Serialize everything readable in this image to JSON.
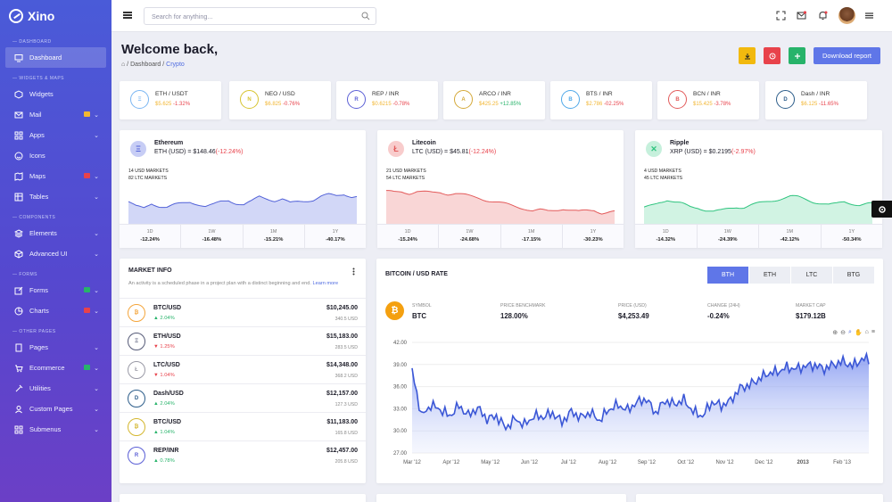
{
  "app": {
    "name": "Xino"
  },
  "sidebar": {
    "sections": [
      "DASHBOARD",
      "WIDGETS & MAPS",
      "COMPONENTS",
      "FORMS",
      "OTHER PAGES"
    ],
    "items": [
      {
        "label": "Dashboard"
      },
      {
        "label": "Widgets"
      },
      {
        "label": "Mail",
        "badge": "5"
      },
      {
        "label": "Apps"
      },
      {
        "label": "Icons"
      },
      {
        "label": "Maps",
        "badge": "2"
      },
      {
        "label": "Tables"
      },
      {
        "label": "Elements"
      },
      {
        "label": "Advanced UI"
      },
      {
        "label": "Forms",
        "badge": "4"
      },
      {
        "label": "Charts",
        "badge": "6"
      },
      {
        "label": "Pages"
      },
      {
        "label": "Ecommerce",
        "badge": "9"
      },
      {
        "label": "Utilities"
      },
      {
        "label": "Custom Pages"
      },
      {
        "label": "Submenus"
      }
    ]
  },
  "topbar": {
    "search_placeholder": "Search for anything..."
  },
  "page": {
    "title": "Welcome back,",
    "breadcrumb": [
      "Dashboard",
      "Crypto"
    ],
    "download_label": "Download report"
  },
  "tickers": [
    {
      "pair": "ETH / USDT",
      "price": "$5.625",
      "change": "-1.32%",
      "color": "#7ab6f2",
      "sym": "Ξ"
    },
    {
      "pair": "NEO / USD",
      "price": "$6.825",
      "change": "-0.76%",
      "color": "#d7c42f",
      "sym": "N"
    },
    {
      "pair": "REP / INR",
      "price": "$0.6215",
      "change": "-0.78%",
      "color": "#5b5fd6",
      "sym": "R"
    },
    {
      "pair": "ARCO / INR",
      "price": "$425.25",
      "change": "+12.85%",
      "color": "#d4a838",
      "sym": "A"
    },
    {
      "pair": "BTS / INR",
      "price": "$2.786",
      "change": "-02.25%",
      "color": "#4fa8e8",
      "sym": "B"
    },
    {
      "pair": "BCN / INR",
      "price": "$15.425",
      "change": "-3.78%",
      "color": "#e25b5b",
      "sym": "B"
    },
    {
      "pair": "Dash / INR",
      "price": "$6.125",
      "change": "-11.65%",
      "color": "#2c5d8a",
      "sym": "D"
    }
  ],
  "coins": [
    {
      "name": "Ethereum",
      "price_text": "ETH (USD) = $148.46",
      "change": "(-12.24%)",
      "m1": "14 USD MARKETS",
      "m2": "82 LTC MARKETS",
      "color": "#5161d8",
      "stats": [
        {
          "l": "1D",
          "v": "-12.24%"
        },
        {
          "l": "1W",
          "v": "-16.48%"
        },
        {
          "l": "1M",
          "v": "-15.21%"
        },
        {
          "l": "1Y",
          "v": "-40.17%"
        }
      ]
    },
    {
      "name": "Litecoin",
      "price_text": "LTC (USD) = $45.81",
      "change": "(-12.24%)",
      "m1": "21 USD MARKETS",
      "m2": "54 LTC MARKETS",
      "color": "#e35a5a",
      "stats": [
        {
          "l": "1D",
          "v": "-15.24%"
        },
        {
          "l": "1W",
          "v": "-24.68%"
        },
        {
          "l": "1M",
          "v": "-17.15%"
        },
        {
          "l": "1Y",
          "v": "-30.23%"
        }
      ]
    },
    {
      "name": "Ripple",
      "price_text": "XRP (USD) = $0.2195",
      "change": "(-2.97%)",
      "m1": "4 USD MARKETS",
      "m2": "45 LTC MARKETS",
      "color": "#2fc47f",
      "stats": [
        {
          "l": "1D",
          "v": "-14.32%"
        },
        {
          "l": "1W",
          "v": "-24.39%"
        },
        {
          "l": "1M",
          "v": "-42.12%"
        },
        {
          "l": "1Y",
          "v": "-50.34%"
        }
      ]
    }
  ],
  "market": {
    "title": "MARKET INFO",
    "desc": "An activity is a scheduled phase in a project plan with a distinct beginning and end.",
    "learn": "Learn more",
    "rows": [
      {
        "pair": "BTC/USD",
        "change": "2.04%",
        "dir": "up",
        "value": "$10,245.00",
        "sub": "340.5 USD",
        "color": "#f4a53b",
        "sym": "₿"
      },
      {
        "pair": "ETH/USD",
        "change": "1.25%",
        "dir": "down",
        "value": "$15,183.00",
        "sub": "283.5 USD",
        "color": "#555a77",
        "sym": "Ξ"
      },
      {
        "pair": "LTC/USD",
        "change": "1.04%",
        "dir": "down",
        "value": "$14,348.00",
        "sub": "368.2 USD",
        "color": "#9a9aa6",
        "sym": "Ł"
      },
      {
        "pair": "Dash/USD",
        "change": "2.04%",
        "dir": "up",
        "value": "$12,157.00",
        "sub": "127.3 USD",
        "color": "#2c5d8a",
        "sym": "D"
      },
      {
        "pair": "BTC/USD",
        "change": "1.04%",
        "dir": "up",
        "value": "$11,183.00",
        "sub": "165.8 USD",
        "color": "#d4b72f",
        "sym": "₿"
      },
      {
        "pair": "REP/INR",
        "change": "0.78%",
        "dir": "up",
        "value": "$12,457.00",
        "sub": "205.8 USD",
        "color": "#5b5fd6",
        "sym": "R"
      }
    ]
  },
  "rate": {
    "title": "BITCOIN / USD RATE",
    "tabs": [
      "BTH",
      "ETH",
      "LTC",
      "BTG"
    ],
    "info": [
      {
        "k": "SYMBOL",
        "v": "BTC"
      },
      {
        "k": "PRICE BENCHMARK",
        "v": "128.00%"
      },
      {
        "k": "PRICE (USD)",
        "v": "$4,253.49"
      },
      {
        "k": "CHANGE (24H)",
        "v": "-0.24%"
      },
      {
        "k": "MARKET CAP",
        "v": "$179.12B"
      }
    ]
  },
  "chart_data": {
    "type": "area",
    "x": [
      "Mar '12",
      "Apr '12",
      "May '12",
      "Jun '12",
      "Jul '12",
      "Aug '12",
      "Sep '12",
      "Oct '12",
      "Nov '12",
      "Dec '12",
      "2013",
      "Feb '13"
    ],
    "ylim": [
      27,
      42
    ],
    "yticks": [
      "42.00",
      "39.00",
      "36.00",
      "33.00",
      "30.00",
      "27.00"
    ],
    "series": [
      {
        "values": [
          38.2,
          32.0,
          33.5,
          32.9,
          32.0,
          33.4,
          32.1,
          33.1,
          31.6,
          32.0,
          30.4,
          31.6,
          30.8,
          32.0,
          31.9,
          32.4,
          31.2,
          32.6,
          31.8,
          32.5,
          31.4,
          32.9,
          33.5,
          32.8,
          33.9,
          34.3,
          32.4,
          34.1,
          33.6,
          34.2,
          32.6,
          32.0,
          33.9,
          33.4,
          34.1,
          35.8,
          36.2,
          37.0,
          37.8,
          38.0,
          38.6,
          38.4,
          38.8,
          38.9,
          38.4,
          39.0,
          39.4,
          38.8,
          39.7
        ]
      }
    ],
    "color": "#3b57d6"
  }
}
